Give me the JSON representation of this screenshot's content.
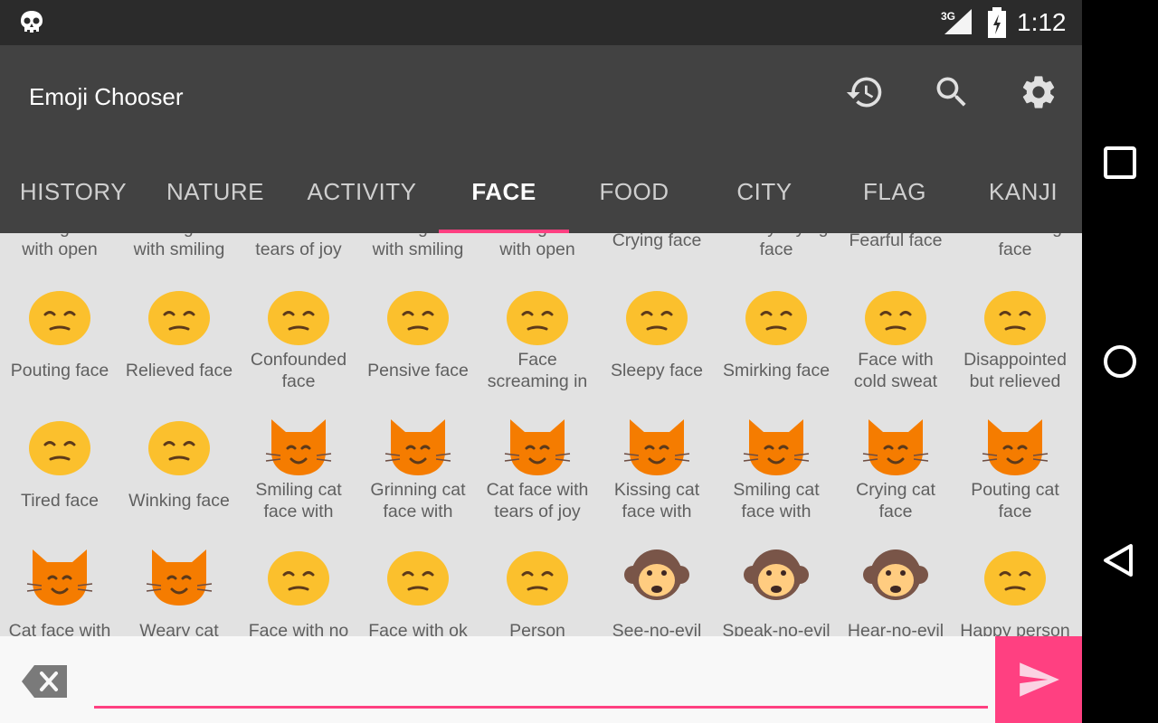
{
  "status_bar": {
    "network": "3G",
    "time": "1:12"
  },
  "app_bar": {
    "title": "Emoji Chooser",
    "actions": [
      "history-icon",
      "search-icon",
      "settings-icon"
    ]
  },
  "tabs": [
    "HISTORY",
    "NATURE",
    "ACTIVITY",
    "FACE",
    "FOOD",
    "CITY",
    "FLAG",
    "KANJI"
  ],
  "active_tab": "FACE",
  "grid": {
    "partial_row": [
      {
        "caption": "Smiling face\nwith open"
      },
      {
        "caption": "Grinning face\nwith smiling"
      },
      {
        "caption": "Face with\ntears of joy"
      },
      {
        "caption": "Smiling face\nwith smiling"
      },
      {
        "caption": "Smiling face\nwith open"
      },
      {
        "caption": "Crying face"
      },
      {
        "caption": "Loudly crying\nface"
      },
      {
        "caption": "Fearful face"
      },
      {
        "caption": "Persevering\nface"
      }
    ],
    "rows": [
      [
        {
          "caption": "Pouting face",
          "icon": "pouting-face-icon",
          "kind": "face",
          "color": "#fbc02d"
        },
        {
          "caption": "Relieved face",
          "icon": "relieved-face-icon",
          "kind": "face",
          "color": "#fbc02d"
        },
        {
          "caption": "Confounded\nface",
          "icon": "confounded-face-icon",
          "kind": "face",
          "color": "#fbc02d"
        },
        {
          "caption": "Pensive face",
          "icon": "pensive-face-icon",
          "kind": "face",
          "color": "#fbc02d"
        },
        {
          "caption": "Face\nscreaming in",
          "icon": "face-screaming-icon",
          "kind": "face",
          "color": "#fbc02d"
        },
        {
          "caption": "Sleepy face",
          "icon": "sleepy-face-icon",
          "kind": "face",
          "color": "#fbc02d"
        },
        {
          "caption": "Smirking face",
          "icon": "smirking-face-icon",
          "kind": "face",
          "color": "#fbc02d"
        },
        {
          "caption": "Face with\ncold sweat",
          "icon": "cold-sweat-face-icon",
          "kind": "face",
          "color": "#fbc02d"
        },
        {
          "caption": "Disappointed\nbut relieved",
          "icon": "disappointed-relieved-face-icon",
          "kind": "face",
          "color": "#fbc02d"
        }
      ],
      [
        {
          "caption": "Tired face",
          "icon": "tired-face-icon",
          "kind": "face",
          "color": "#fbc02d"
        },
        {
          "caption": "Winking face",
          "icon": "winking-face-icon",
          "kind": "face",
          "color": "#fbc02d"
        },
        {
          "caption": "Smiling cat\nface with",
          "icon": "smiling-cat-icon",
          "kind": "cat",
          "color": "#f57c00"
        },
        {
          "caption": "Grinning cat\nface with",
          "icon": "grinning-cat-icon",
          "kind": "cat",
          "color": "#f57c00"
        },
        {
          "caption": "Cat face with\ntears of joy",
          "icon": "cat-tears-of-joy-icon",
          "kind": "cat",
          "color": "#f57c00"
        },
        {
          "caption": "Kissing cat\nface with",
          "icon": "kissing-cat-icon",
          "kind": "cat",
          "color": "#f57c00"
        },
        {
          "caption": "Smiling cat\nface with",
          "icon": "heart-eyes-cat-icon",
          "kind": "cat",
          "color": "#f57c00"
        },
        {
          "caption": "Crying cat\nface",
          "icon": "crying-cat-icon",
          "kind": "cat",
          "color": "#f57c00"
        },
        {
          "caption": "Pouting cat\nface",
          "icon": "pouting-cat-icon",
          "kind": "cat",
          "color": "#f57c00"
        }
      ],
      [
        {
          "caption": "Cat face with",
          "icon": "cat-wry-smile-icon",
          "kind": "cat",
          "color": "#f57c00"
        },
        {
          "caption": "Weary cat",
          "icon": "weary-cat-icon",
          "kind": "cat",
          "color": "#f57c00"
        },
        {
          "caption": "Face with no",
          "icon": "no-good-face-icon",
          "kind": "face",
          "color": "#fbc02d"
        },
        {
          "caption": "Face with ok",
          "icon": "ok-gesture-face-icon",
          "kind": "face",
          "color": "#fbc02d"
        },
        {
          "caption": "Person",
          "icon": "person-bowing-icon",
          "kind": "face",
          "color": "#fbc02d"
        },
        {
          "caption": "See-no-evil",
          "icon": "see-no-evil-monkey-icon",
          "kind": "monkey",
          "color": "#795548"
        },
        {
          "caption": "Speak-no-evil",
          "icon": "speak-no-evil-monkey-icon",
          "kind": "monkey",
          "color": "#795548"
        },
        {
          "caption": "Hear-no-evil",
          "icon": "hear-no-evil-monkey-icon",
          "kind": "monkey",
          "color": "#795548"
        },
        {
          "caption": "Happy person",
          "icon": "happy-person-raising-hand-icon",
          "kind": "face",
          "color": "#fbc02d"
        }
      ]
    ]
  },
  "input": {
    "value": "",
    "placeholder": ""
  },
  "colors": {
    "accent": "#ff4081",
    "app_bar": "#424242",
    "status_bar": "#2b2b2b",
    "grid_bg": "#e2e2e2",
    "caption": "#5f5f5f"
  }
}
